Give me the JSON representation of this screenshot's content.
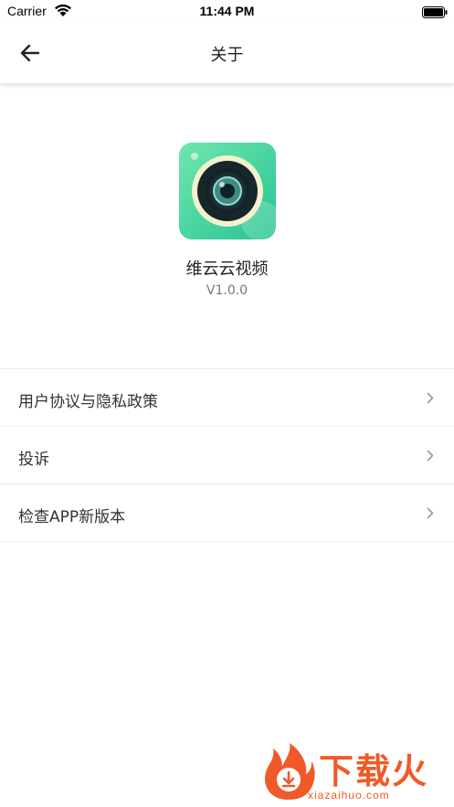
{
  "status_bar": {
    "carrier": "Carrier",
    "time": "11:44 PM",
    "wifi_icon": "wifi-icon",
    "battery_icon": "battery-full-icon"
  },
  "nav": {
    "title": "关于",
    "back_icon": "arrow-left-icon"
  },
  "app": {
    "name": "维云云视频",
    "version": "V1.0.0",
    "icon": "camera-lens-icon",
    "icon_colors": {
      "gradient_start": "#5ee0a8",
      "gradient_end": "#2ec995",
      "lens_ring": "#f1f1c9"
    }
  },
  "menu": {
    "items": [
      {
        "label": "用户协议与隐私政策",
        "icon": "chevron-right-icon"
      },
      {
        "label": "投诉",
        "icon": "chevron-right-icon"
      },
      {
        "label": "检查APP新版本",
        "icon": "chevron-right-icon"
      }
    ]
  },
  "watermark": {
    "logo_text": "下载火",
    "site": "xiazaihuo.com",
    "logo_icon": "flame-download-icon",
    "color": "#f05a28"
  }
}
